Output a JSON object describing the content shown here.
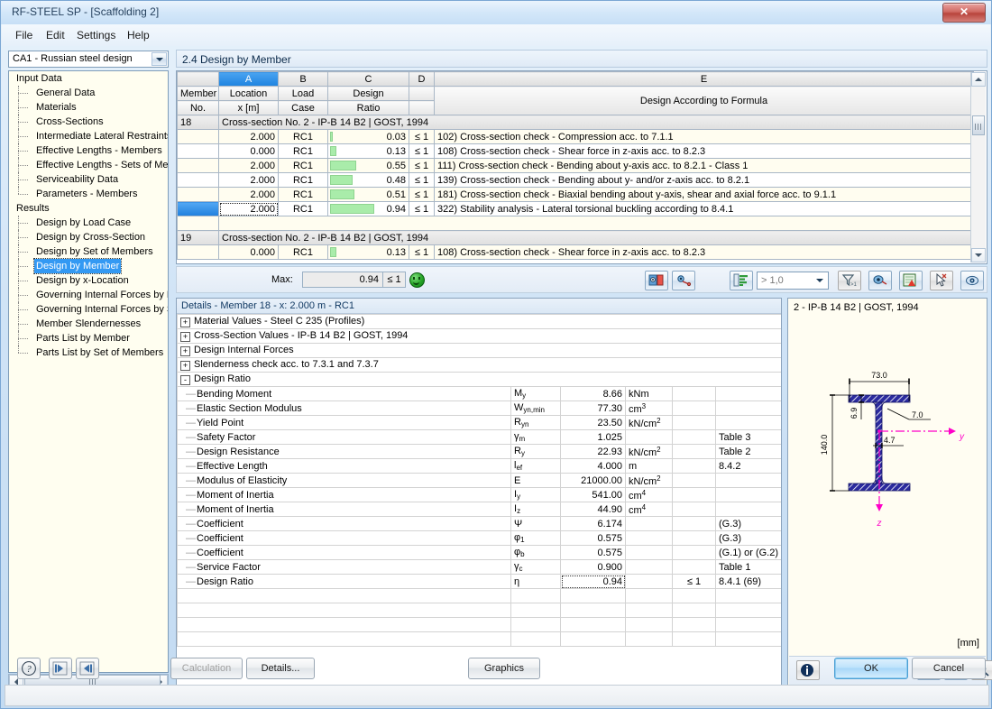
{
  "window": {
    "title": "RF-STEEL SP - [Scaffolding 2]",
    "close_label": "✕"
  },
  "menu": [
    {
      "label": "File"
    },
    {
      "label": "Edit"
    },
    {
      "label": "Settings"
    },
    {
      "label": "Help"
    }
  ],
  "sidebar": {
    "combo_value": "CA1 - Russian steel design",
    "items": [
      {
        "label": "Input Data",
        "type": "root"
      },
      {
        "label": "General Data",
        "type": "child"
      },
      {
        "label": "Materials",
        "type": "child"
      },
      {
        "label": "Cross-Sections",
        "type": "child"
      },
      {
        "label": "Intermediate Lateral Restraints",
        "type": "child"
      },
      {
        "label": "Effective Lengths - Members",
        "type": "child"
      },
      {
        "label": "Effective Lengths - Sets of Mem",
        "type": "child"
      },
      {
        "label": "Serviceability Data",
        "type": "child"
      },
      {
        "label": "Parameters - Members",
        "type": "child-last"
      },
      {
        "label": "Results",
        "type": "root"
      },
      {
        "label": "Design by Load Case",
        "type": "child"
      },
      {
        "label": "Design by Cross-Section",
        "type": "child"
      },
      {
        "label": "Design by Set of Members",
        "type": "child"
      },
      {
        "label": "Design by Member",
        "type": "child",
        "selected": true
      },
      {
        "label": "Design by x-Location",
        "type": "child"
      },
      {
        "label": "Governing Internal Forces by M",
        "type": "child"
      },
      {
        "label": "Governing Internal Forces by Se",
        "type": "child"
      },
      {
        "label": "Member Slendernesses",
        "type": "child"
      },
      {
        "label": "Parts List by Member",
        "type": "child"
      },
      {
        "label": "Parts List by Set of Members",
        "type": "child-last"
      }
    ]
  },
  "panel": {
    "title": "2.4 Design by Member"
  },
  "grid": {
    "column_letters": [
      "",
      "A",
      "B",
      "C",
      "D",
      "E"
    ],
    "active_letter": "A",
    "headers": [
      {
        "line1": "Member",
        "line2": "No."
      },
      {
        "line1": "Location",
        "line2": "x [m]"
      },
      {
        "line1": "Load",
        "line2": "Case"
      },
      {
        "line1": "Design",
        "line2": "Ratio"
      },
      {
        "line1": "",
        "line2": ""
      },
      {
        "line1": "Design According to Formula",
        "line2": ""
      }
    ],
    "rows": [
      {
        "kind": "section",
        "member": "18",
        "text": "Cross-section No.  2 - IP-B 14 B2 | GOST, 1994"
      },
      {
        "kind": "data",
        "member": "",
        "location": "2.000",
        "load_case": "RC1",
        "ratio": "0.03",
        "bar_pct": 3,
        "cmp": "≤ 1",
        "formula": "102) Cross-section check - Compression acc. to 7.1.1"
      },
      {
        "kind": "data",
        "member": "",
        "location": "0.000",
        "load_case": "RC1",
        "ratio": "0.13",
        "bar_pct": 13,
        "cmp": "≤ 1",
        "formula": "108) Cross-section check - Shear force in z-axis acc. to 8.2.3"
      },
      {
        "kind": "data",
        "member": "",
        "location": "2.000",
        "load_case": "RC1",
        "ratio": "0.55",
        "bar_pct": 55,
        "cmp": "≤ 1",
        "formula": "111) Cross-section check - Bending about y-axis acc. to 8.2.1 - Class 1"
      },
      {
        "kind": "data",
        "member": "",
        "location": "2.000",
        "load_case": "RC1",
        "ratio": "0.48",
        "bar_pct": 48,
        "cmp": "≤ 1",
        "formula": "139) Cross-section check - Bending about y- and/or z-axis acc. to 8.2.1"
      },
      {
        "kind": "data",
        "member": "",
        "location": "2.000",
        "load_case": "RC1",
        "ratio": "0.51",
        "bar_pct": 51,
        "cmp": "≤ 1",
        "formula": "181) Cross-section check - Biaxial bending about y-axis, shear and axial force acc. to 9.1.1"
      },
      {
        "kind": "data",
        "member": "",
        "location": "2.000",
        "load_case": "RC1",
        "ratio": "0.94",
        "bar_pct": 94,
        "cmp": "≤ 1",
        "formula": "322) Stability analysis - Lateral torsional buckling according to 8.4.1",
        "selected": true
      },
      {
        "kind": "blank"
      },
      {
        "kind": "section",
        "member": "19",
        "text": "Cross-section No.  2 - IP-B 14 B2 | GOST, 1994"
      },
      {
        "kind": "data",
        "member": "",
        "location": "0.000",
        "load_case": "RC1",
        "ratio": "0.13",
        "bar_pct": 13,
        "cmp": "≤ 1",
        "formula": "108) Cross-section check - Shear force in z-axis acc. to 8.2.3"
      }
    ]
  },
  "maxbar": {
    "label": "Max:",
    "value": "0.94",
    "comparison": "≤ 1",
    "status_icon": "green-smiley-icon",
    "filter_value": "> 1,0"
  },
  "details": {
    "caption": "Details - Member 18 - x: 2.000 m - RC1",
    "groups": [
      {
        "expander": "+",
        "label": "Material Values - Steel C 235 (Profiles)"
      },
      {
        "expander": "+",
        "label": "Cross-Section Values  -  IP-B 14 B2 | GOST, 1994"
      },
      {
        "expander": "+",
        "label": "Design Internal Forces"
      },
      {
        "expander": "+",
        "label": "Slenderness check acc. to 7.3.1 and 7.3.7"
      },
      {
        "expander": "-",
        "label": "Design Ratio"
      }
    ],
    "column_widths": [
      "370",
      "55",
      "72",
      "52",
      "48",
      "73"
    ],
    "rows": [
      {
        "label": "Bending Moment",
        "symbol": "M",
        "sub": "y",
        "value": "8.66",
        "unit": "kNm",
        "unit_sup": "",
        "cmp": "",
        "ref": ""
      },
      {
        "label": "Elastic Section Modulus",
        "symbol": "W",
        "sub": "yn,min",
        "value": "77.30",
        "unit": "cm",
        "unit_sup": "3",
        "cmp": "",
        "ref": ""
      },
      {
        "label": "Yield Point",
        "symbol": "R",
        "sub": "yn",
        "value": "23.50",
        "unit": "kN/cm",
        "unit_sup": "2",
        "cmp": "",
        "ref": ""
      },
      {
        "label": "Safety Factor",
        "symbol": "γ",
        "sub": "m",
        "value": "1.025",
        "unit": "",
        "unit_sup": "",
        "cmp": "",
        "ref": "Table 3"
      },
      {
        "label": "Design Resistance",
        "symbol": "R",
        "sub": "y",
        "value": "22.93",
        "unit": "kN/cm",
        "unit_sup": "2",
        "cmp": "",
        "ref": "Table 2"
      },
      {
        "label": "Effective Length",
        "symbol": "l",
        "sub": "ef",
        "value": "4.000",
        "unit": "m",
        "unit_sup": "",
        "cmp": "",
        "ref": "8.4.2"
      },
      {
        "label": "Modulus of Elasticity",
        "symbol": "E",
        "sub": "",
        "value": "21000.00",
        "unit": "kN/cm",
        "unit_sup": "2",
        "cmp": "",
        "ref": ""
      },
      {
        "label": "Moment of Inertia",
        "symbol": "I",
        "sub": "y",
        "value": "541.00",
        "unit": "cm",
        "unit_sup": "4",
        "cmp": "",
        "ref": ""
      },
      {
        "label": "Moment of Inertia",
        "symbol": "I",
        "sub": "z",
        "value": "44.90",
        "unit": "cm",
        "unit_sup": "4",
        "cmp": "",
        "ref": ""
      },
      {
        "label": "Coefficient",
        "symbol": "Ψ",
        "sub": "",
        "value": "6.174",
        "unit": "",
        "unit_sup": "",
        "cmp": "",
        "ref": "(G.3)"
      },
      {
        "label": "Coefficient",
        "symbol": "φ",
        "sub": "1",
        "value": "0.575",
        "unit": "",
        "unit_sup": "",
        "cmp": "",
        "ref": "(G.3)"
      },
      {
        "label": "Coefficient",
        "symbol": "φ",
        "sub": "b",
        "value": "0.575",
        "unit": "",
        "unit_sup": "",
        "cmp": "",
        "ref": "(G.1) or (G.2)"
      },
      {
        "label": "Service Factor",
        "symbol": "γ",
        "sub": "c",
        "value": "0.900",
        "unit": "",
        "unit_sup": "",
        "cmp": "",
        "ref": "Table 1"
      },
      {
        "label": "Design Ratio",
        "symbol": "η",
        "sub": "",
        "value": "0.94",
        "unit": "",
        "unit_sup": "",
        "cmp": "≤ 1",
        "ref": "8.4.1 (69)",
        "current": true
      }
    ]
  },
  "section_view": {
    "title": "2 - IP-B 14 B2 | GOST, 1994",
    "unit": "[mm]",
    "dimensions": {
      "width": "73.0",
      "height": "140.0",
      "flange_thickness": "6.9",
      "flange_note": "7.0",
      "web_thickness": "4.7"
    },
    "axis_y": "y",
    "axis_z": "z"
  },
  "bottom": {
    "help_icon": "question-mark-icon",
    "prev_icon": "previous-arrow-icon",
    "next_icon": "next-arrow-icon",
    "calculation": "Calculation",
    "details": "Details...",
    "graphics": "Graphics",
    "ok": "OK",
    "cancel": "Cancel"
  }
}
